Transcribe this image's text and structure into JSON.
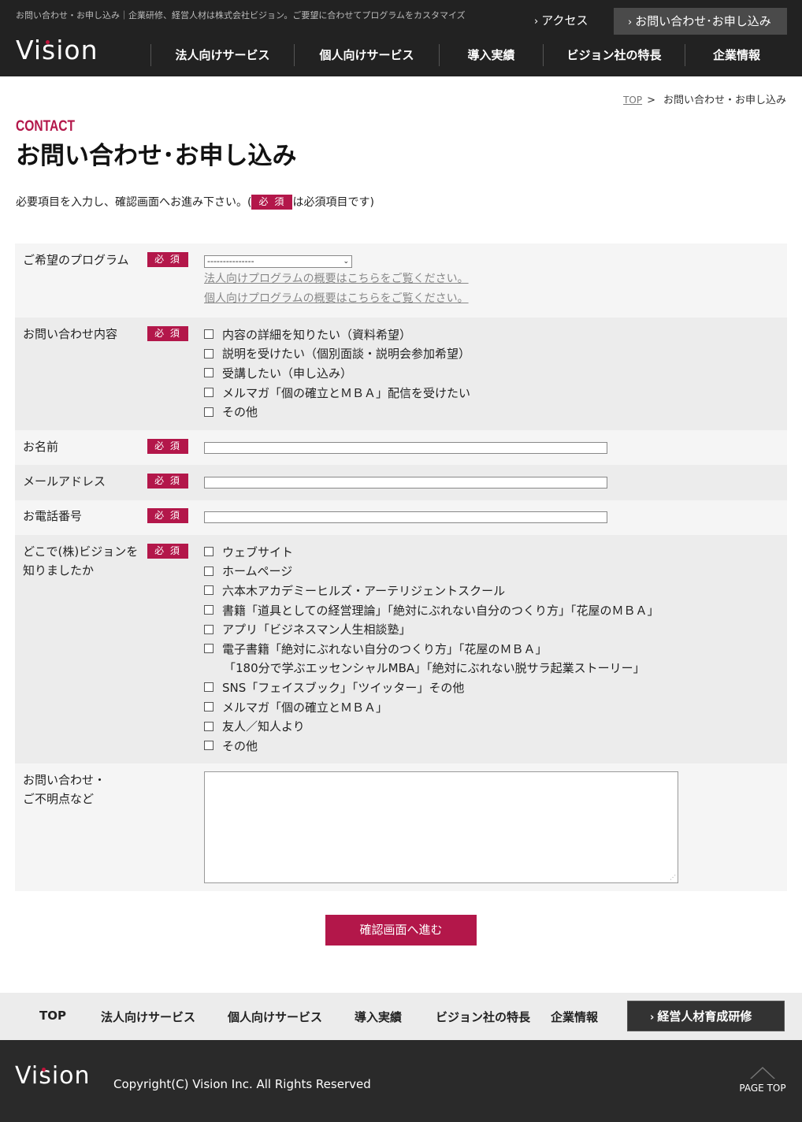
{
  "header": {
    "tagline": "お問い合わせ・お申し込み｜企業研修、経営人材は株式会社ビジョン。ご要望に合わせてプログラムをカスタマイズ",
    "logo": "Vision",
    "access_label": "アクセス",
    "contact_label": "お問い合わせ･お申し込み",
    "nav": [
      "法人向けサービス",
      "個人向けサービス",
      "導入実績",
      "ビジョン社の特長",
      "企業情報"
    ]
  },
  "breadcrumb": {
    "top": "TOP",
    "separator": ">",
    "current": "お問い合わせ・お申し込み"
  },
  "title": {
    "en": "CONTACT",
    "ja": "お問い合わせ･お申し込み"
  },
  "intro": {
    "before": "必要項目を入力し、確認画面へお進み下さい。(",
    "after": "は必須項目です)"
  },
  "required_label": "必 須",
  "form": {
    "program": {
      "label": "ご希望のプログラム",
      "select_value": "---------------",
      "links": [
        "法人向けプログラムの概要はこちらをご覧ください。",
        "個人向けプログラムの概要はこちらをご覧ください。"
      ]
    },
    "inquiry": {
      "label": "お問い合わせ内容",
      "options": [
        "内容の詳細を知りたい（資料希望）",
        "説明を受けたい（個別面談・説明会参加希望）",
        "受講したい（申し込み）",
        "メルマガ「個の確立とＭＢＡ」配信を受けたい",
        "その他"
      ]
    },
    "name": {
      "label": "お名前",
      "value": ""
    },
    "email": {
      "label": "メールアドレス",
      "value": ""
    },
    "phone": {
      "label": "お電話番号",
      "value": ""
    },
    "source": {
      "label_line1": "どこで(株)ビジョンを",
      "label_line2": "知りましたか",
      "options": [
        "ウェブサイト",
        "ホームページ",
        "六本木アカデミーヒルズ・アーテリジェントスクール",
        "書籍「道具としての経営理論」「絶対にぶれない自分のつくり方」「花屋のＭＢＡ」",
        "アプリ「ビジネスマン人生相談塾」",
        " 電子書籍「絶対にぶれない自分のつくり方」「花屋のＭＢＡ」"
      ],
      "option6_cont": "「180分で学ぶエッセンシャルMBA」「絶対にぶれない脱サラ起業ストーリー」",
      "options_rest": [
        "SNS「フェイスブック」「ツイッター」その他",
        "メルマガ「個の確立とＭＢＡ」",
        "友人／知人より",
        "その他"
      ]
    },
    "message": {
      "label_line1": "お問い合わせ・",
      "label_line2": "ご不明点など",
      "value": ""
    },
    "submit_label": "確認画面へ進む"
  },
  "footer_nav": {
    "items": [
      "TOP",
      "法人向けサービス",
      "個人向けサービス",
      "導入実績",
      "ビジョン社の特長",
      "企業情報"
    ],
    "button": "経営人材育成研修"
  },
  "footer": {
    "logo": "Vision",
    "copyright": "Copyright(C) Vision Inc. All Rights Reserved",
    "page_top": "PAGE TOP"
  },
  "colors": {
    "accent": "#b3174a",
    "header_bg": "#222222",
    "footer_bg": "#2a2a2a"
  }
}
